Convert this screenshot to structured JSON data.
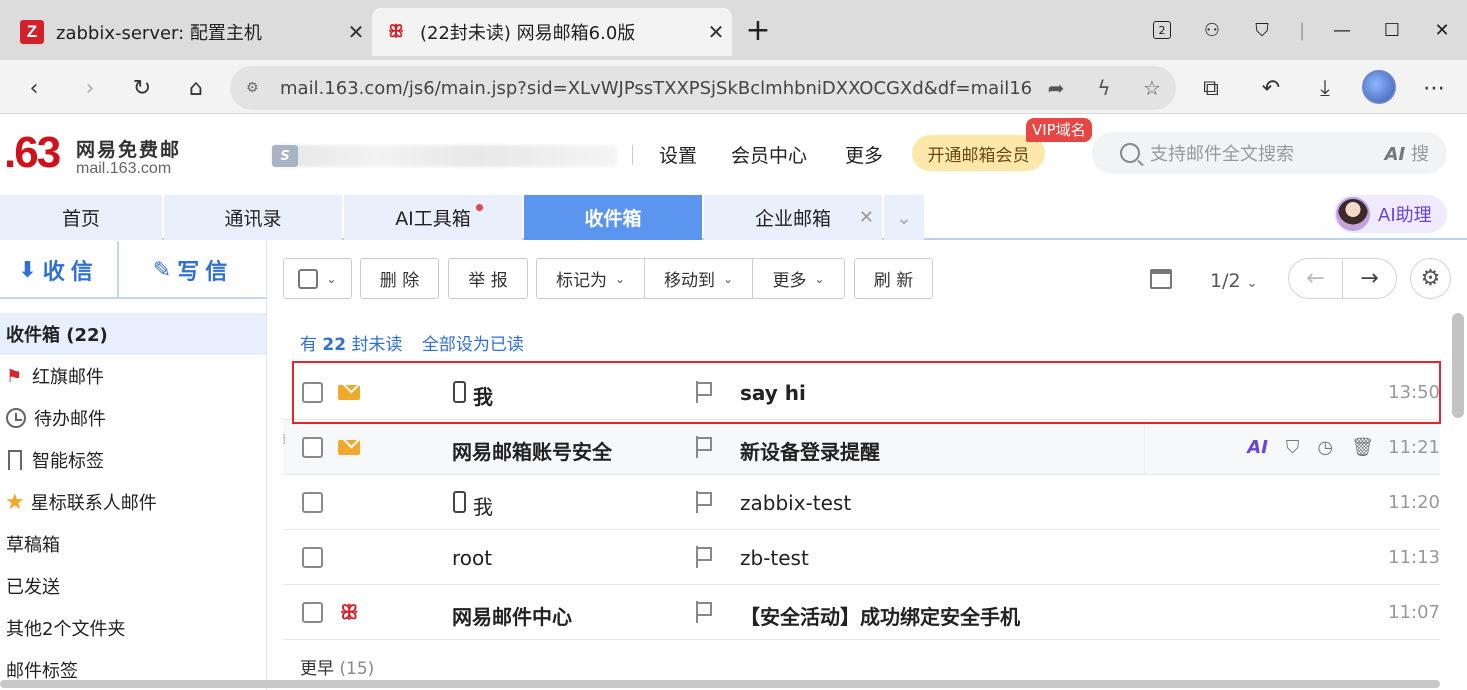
{
  "browser": {
    "tabs": [
      {
        "title": "zabbix-server: 配置主机",
        "favicon": "Z"
      },
      {
        "title": "(22封未读) 网易邮箱6.0版",
        "favicon": "163"
      }
    ],
    "new_tab": "+",
    "url": "mail.163.com/js6/main.jsp?sid=XLvWJPssTXXPSjSkBclmhbniDXXOCGXd&df=mail163...",
    "tab_count_badge": "2"
  },
  "header": {
    "logo_number": ".63",
    "logo_cn": "网易免费邮",
    "logo_en": "mail.163.com",
    "links": [
      "设置",
      "会员中心",
      "更多"
    ],
    "vip_button": "开通邮箱会员",
    "vip_tag": "VIP域名",
    "search_placeholder": "支持邮件全文搜索",
    "search_ai": "AI",
    "search_ai_suffix": "搜"
  },
  "module_tabs": [
    {
      "label": "首页"
    },
    {
      "label": "通讯录"
    },
    {
      "label": "AI工具箱"
    },
    {
      "label": "收件箱"
    },
    {
      "label": "企业邮箱"
    }
  ],
  "ai_helper": "AI助理",
  "sidebar": {
    "receive": "收信",
    "compose": "写信",
    "folders": [
      {
        "label": "收件箱 (22)"
      },
      {
        "label": "红旗邮件"
      },
      {
        "label": "待办邮件"
      },
      {
        "label": "智能标签"
      },
      {
        "label": "星标联系人邮件"
      },
      {
        "label": "草稿箱"
      },
      {
        "label": "已发送"
      },
      {
        "label": "其他2个文件夹"
      },
      {
        "label": "邮件标签"
      }
    ]
  },
  "toolbar": {
    "delete": "删 除",
    "report": "举 报",
    "mark_as": "标记为",
    "move_to": "移动到",
    "more": "更多",
    "refresh": "刷 新",
    "page": "1/2"
  },
  "list": {
    "unread_prefix": "有",
    "unread_count": "22",
    "unread_suffix": "封未读",
    "mark_all_read": "全部设为已读",
    "rows": [
      {
        "sender": "我",
        "subject": "say hi",
        "time": "13:50"
      },
      {
        "sender": "网易邮箱账号安全",
        "subject": "新设备登录提醒",
        "time": "11:21"
      },
      {
        "sender": "我",
        "subject": "zabbix-test",
        "time": "11:20"
      },
      {
        "sender": "root",
        "subject": "zb-test",
        "time": "11:13"
      },
      {
        "sender": "网易邮件中心",
        "subject": "【安全活动】成功绑定安全手机",
        "time": "11:07"
      }
    ],
    "older_label": "更早",
    "older_count": "(15)"
  },
  "colors": {
    "accent": "#5b95f0",
    "brand_red": "#d0111b",
    "highlight_border": "#e0262e"
  }
}
